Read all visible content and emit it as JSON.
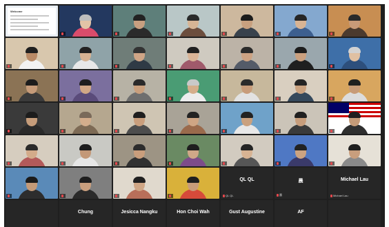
{
  "colors": {
    "background": "#1f1f1f",
    "active_speaker": "#e6d84a",
    "muted_mic": "#e5484d"
  },
  "video_tiles": [
    {
      "name": "",
      "bg": "#e9eef3",
      "kind": "document",
      "doc_title": "Welcome"
    },
    {
      "name": "",
      "bg": "#23385f",
      "kind": "person",
      "skin": "#e3c3a6",
      "hair": "#bdbdbd",
      "shirt": "#d94c6b",
      "active": true
    },
    {
      "name": "",
      "bg": "#5e7f7a",
      "kind": "person",
      "skin": "#c79f80",
      "hair": "#222222",
      "shirt": "#2b2b2b"
    },
    {
      "name": "",
      "bg": "#b9c7c7",
      "kind": "person",
      "skin": "#d7b595",
      "hair": "#2a2a2a",
      "shirt": "#6c4e3e"
    },
    {
      "name": "",
      "bg": "#cdb89e",
      "kind": "person",
      "skin": "#c8a07f",
      "hair": "#1c1c1c",
      "shirt": "#39424c"
    },
    {
      "name": "",
      "bg": "#84a8cf",
      "kind": "person",
      "skin": "#d8b494",
      "hair": "#262626",
      "shirt": "#3d5f8f"
    },
    {
      "name": "",
      "bg": "#c88e52",
      "kind": "person",
      "skin": "#c89a78",
      "hair": "#2a2a2a",
      "shirt": "#4b3a2e"
    },
    {
      "name": "",
      "bg": "#d8c7ad",
      "kind": "person",
      "skin": "#b98a66",
      "hair": "#1f1f1f",
      "shirt": "#f2f2f2"
    },
    {
      "name": "",
      "bg": "#8fa3a8",
      "kind": "person",
      "skin": "#d6b292",
      "hair": "#222222",
      "shirt": "#e8e8e8"
    },
    {
      "name": "",
      "bg": "#6f7d78",
      "kind": "person",
      "skin": "#cfa586",
      "hair": "#333333",
      "shirt": "#2f3a45"
    },
    {
      "name": "",
      "bg": "#cfcac0",
      "kind": "person",
      "skin": "#d9b497",
      "hair": "#202020",
      "shirt": "#a05a6b"
    },
    {
      "name": "",
      "bg": "#bcb3a7",
      "kind": "person",
      "skin": "#cda383",
      "hair": "#2b2b2b",
      "shirt": "#545b68"
    },
    {
      "name": "",
      "bg": "#9aa7ad",
      "kind": "person",
      "skin": "#caa07f",
      "hair": "#1d1d1d",
      "shirt": "#1f1f1f"
    },
    {
      "name": "",
      "bg": "#3e6fa8",
      "kind": "person",
      "skin": "#e0c0a2",
      "hair": "#d2d2d2",
      "shirt": "#2d4f7c"
    },
    {
      "name": "",
      "bg": "#8b7355",
      "kind": "person",
      "skin": "#c59b79",
      "hair": "#1c1c1c",
      "shirt": "#3b3b3b"
    },
    {
      "name": "",
      "bg": "#7b6f9e",
      "kind": "person",
      "skin": "#d1a886",
      "hair": "#1e1e1e",
      "shirt": "#5a4b7a"
    },
    {
      "name": "",
      "bg": "#b7b2a5",
      "kind": "person",
      "skin": "#c99f7d",
      "hair": "#2a2a2a",
      "shirt": "#6f6f6f"
    },
    {
      "name": "",
      "bg": "#4a9c74",
      "kind": "person",
      "skin": "#d5ae8b",
      "hair": "#c9c9c9",
      "shirt": "#ededed"
    },
    {
      "name": "",
      "bg": "#c7b89c",
      "kind": "person",
      "skin": "#c89c7a",
      "hair": "#2b2b2b",
      "shirt": "#e2e2e2"
    },
    {
      "name": "",
      "bg": "#d9cfc0",
      "kind": "person",
      "skin": "#caa27f",
      "hair": "#242424",
      "shirt": "#35495c"
    },
    {
      "name": "",
      "bg": "#d8a65f",
      "kind": "person",
      "skin": "#c79b78",
      "hair": "#1f1f1f",
      "shirt": "#dcdcdc"
    },
    {
      "name": "",
      "bg": "#3a3a3a",
      "kind": "person",
      "skin": "#c59c7a",
      "hair": "#1c1c1c",
      "shirt": "#2a2a2a"
    },
    {
      "name": "",
      "bg": "#b5a78f",
      "kind": "person",
      "skin": "#d3ad8c",
      "hair": "#7a6a5a",
      "shirt": "#7d6a55"
    },
    {
      "name": "",
      "bg": "#cfc5b3",
      "kind": "person",
      "skin": "#c99e7c",
      "hair": "#1f1f1f",
      "shirt": "#4d4d4d"
    },
    {
      "name": "",
      "bg": "#a9a397",
      "kind": "person",
      "skin": "#cfa584",
      "hair": "#232323",
      "shirt": "#9a6a4c"
    },
    {
      "name": "",
      "bg": "#6fa2c9",
      "kind": "person",
      "skin": "#caa17f",
      "hair": "#222222",
      "shirt": "#e8e8e8"
    },
    {
      "name": "",
      "bg": "#cbc4b8",
      "kind": "person",
      "skin": "#c79d7b",
      "hair": "#202020",
      "shirt": "#3a3a3a"
    },
    {
      "name": "",
      "bg": "#ffffff",
      "kind": "flag",
      "skin": "#c59b78",
      "hair": "#1f1f1f",
      "shirt": "#2f2f2f"
    },
    {
      "name": "",
      "bg": "#d6cdbf",
      "kind": "person",
      "skin": "#d3ab8a",
      "hair": "#2a2a2a",
      "shirt": "#b35a5a"
    },
    {
      "name": "",
      "bg": "#c9c9c4",
      "kind": "person",
      "skin": "#c39878",
      "hair": "#1d1d1d",
      "shirt": "#e6e6e6"
    },
    {
      "name": "",
      "bg": "#9d9484",
      "kind": "person",
      "skin": "#c99e7c",
      "hair": "#2c2c2c",
      "shirt": "#313131"
    },
    {
      "name": "",
      "bg": "#6a8a63",
      "kind": "person",
      "skin": "#cfa888",
      "hair": "#1e1e1e",
      "shirt": "#7d4c8a"
    },
    {
      "name": "",
      "bg": "#d2cbc0",
      "kind": "person",
      "skin": "#d7b393",
      "hair": "#242424",
      "shirt": "#565656"
    },
    {
      "name": "",
      "bg": "#4f78c4",
      "kind": "person",
      "skin": "#ccA381",
      "hair": "#222222",
      "shirt": "#3a3a6a"
    },
    {
      "name": "",
      "bg": "#e6e1d7",
      "kind": "person",
      "skin": "#c89e7d",
      "hair": "#1f1f1f",
      "shirt": "#8a8a8a"
    },
    {
      "name": "",
      "bg": "#5a8ab8",
      "kind": "person",
      "skin": "#c49a78",
      "hair": "#1b1b1b",
      "shirt": "#2d2d2d"
    },
    {
      "name": "",
      "bg": "#7f7f7f",
      "kind": "person",
      "skin": "#c99f7e",
      "hair": "#1f1f1f",
      "shirt": "#2a2a2a"
    },
    {
      "name": "",
      "bg": "#e0d9cd",
      "kind": "person",
      "skin": "#cfa685",
      "hair": "#202020",
      "shirt": "#b86f5a"
    },
    {
      "name": "",
      "bg": "#d9b13a",
      "kind": "person",
      "skin": "#c89c7a",
      "hair": "#1f1f1f",
      "shirt": "#d64a3a"
    },
    {
      "kind": "name-only",
      "big": "QL QL",
      "small": "QL QL"
    },
    {
      "kind": "name-only",
      "big": "晨",
      "small": "晨"
    },
    {
      "kind": "name-only",
      "big": "Michael Lau",
      "small": "Michael Lau"
    },
    {
      "kind": "name-only",
      "big": "",
      "small": ""
    },
    {
      "kind": "name-only",
      "big": "Chung",
      "small": "Chung"
    },
    {
      "kind": "name-only",
      "big": "Jesicca Nangku",
      "small": "Jesicca Nangku"
    },
    {
      "kind": "name-only",
      "big": "Hon Choi Wah",
      "small": "Hon Choi Wah"
    },
    {
      "kind": "name-only",
      "big": "Gust Augustine",
      "small": "Gust Augustine"
    },
    {
      "kind": "name-only",
      "big": "AF",
      "small": "AF"
    },
    {
      "kind": "name-only",
      "big": "",
      "small": ""
    }
  ]
}
